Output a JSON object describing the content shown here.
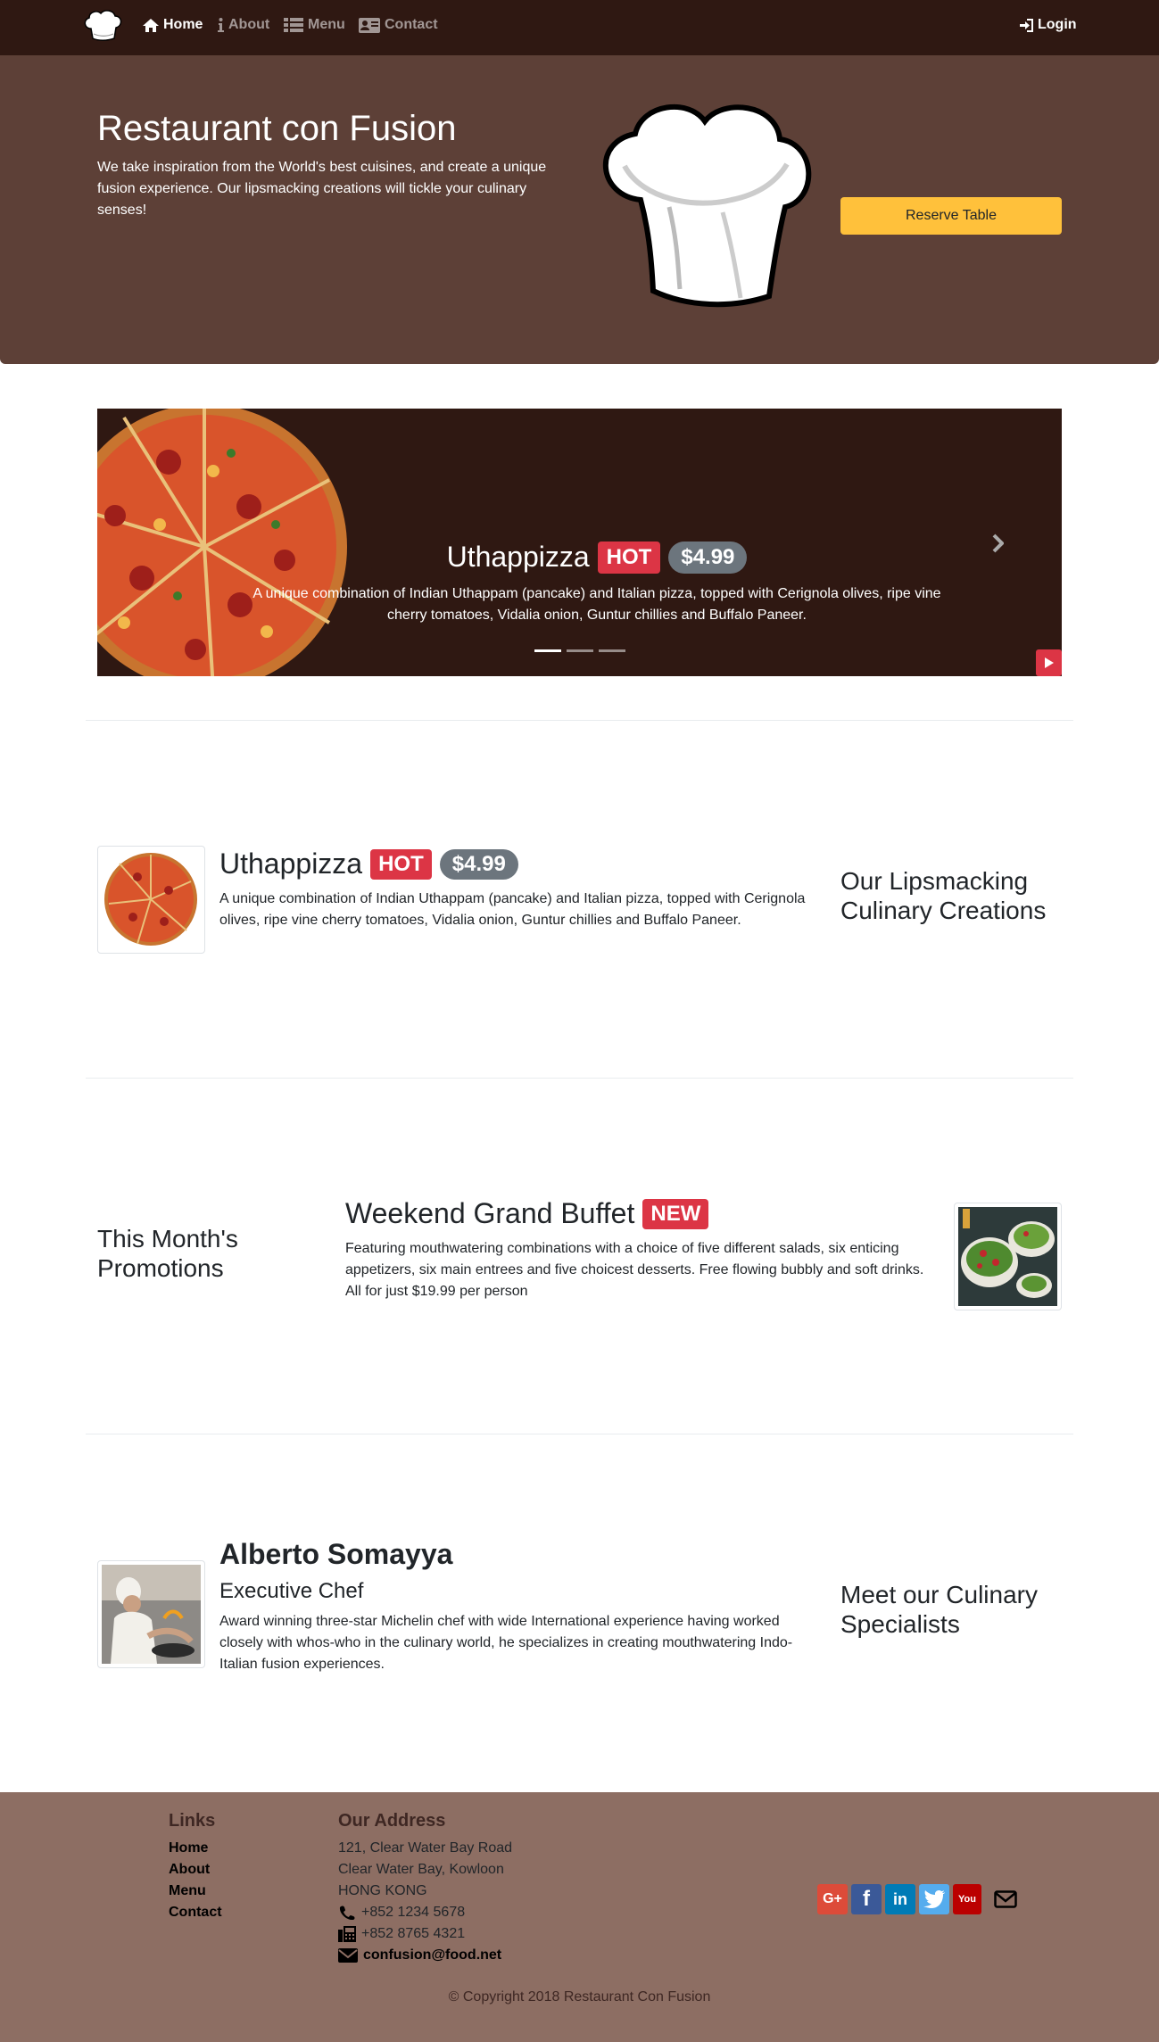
{
  "nav": {
    "items": [
      {
        "label": "Home",
        "icon": "home-icon"
      },
      {
        "label": "About",
        "icon": "info-icon"
      },
      {
        "label": "Menu",
        "icon": "list-icon"
      },
      {
        "label": "Contact",
        "icon": "address-card-icon"
      }
    ],
    "login_label": "Login"
  },
  "jumbotron": {
    "title": "Restaurant con Fusion",
    "text": "We take inspiration from the World's best cuisines, and create a unique fusion experience. Our lipsmacking creations will tickle your culinary senses!",
    "reserve_label": "Reserve Table"
  },
  "carousel": {
    "title": "Uthappizza",
    "badge": "HOT",
    "price": "$4.99",
    "description": "A unique combination of Indian Uthappam (pancake) and Italian pizza, topped with Cerignola olives, ripe vine cherry tomatoes, Vidalia onion, Guntur chillies and Buffalo Paneer.",
    "active_slide": 1,
    "slide_count": 3
  },
  "dish": {
    "title": "Uthappizza",
    "badge": "HOT",
    "price": "$4.99",
    "description": "A unique combination of Indian Uthappam (pancake) and Italian pizza, topped with Cerignola olives, ripe vine cherry tomatoes, Vidalia onion, Guntur chillies and Buffalo Paneer.",
    "side_heading": "Our Lipsmacking Culinary Creations"
  },
  "promotion": {
    "side_heading": "This Month's Promotions",
    "title": "Weekend Grand Buffet",
    "badge": "NEW",
    "description": "Featuring mouthwatering combinations with a choice of five different salads, six enticing appetizers, six main entrees and five choicest desserts. Free flowing bubbly and soft drinks. All for just $19.99 per person"
  },
  "leader": {
    "name": "Alberto Somayya",
    "designation": "Executive Chef",
    "description": "Award winning three-star Michelin chef with wide International experience having worked closely with whos-who in the culinary world, he specializes in creating mouthwatering Indo-Italian fusion experiences.",
    "side_heading": "Meet our Culinary Specialists"
  },
  "footer": {
    "links_heading": "Links",
    "links": [
      "Home",
      "About",
      "Menu",
      "Contact"
    ],
    "address_heading": "Our Address",
    "address": [
      "121, Clear Water Bay Road",
      "Clear Water Bay, Kowloon",
      "HONG KONG"
    ],
    "phone": "+852 1234 5678",
    "fax": "+852 8765 4321",
    "email": "confusion@food.net",
    "social": [
      {
        "name": "google-plus",
        "glyph": "G+",
        "color": "#dd4b39"
      },
      {
        "name": "facebook",
        "glyph": "f",
        "color": "#3b5998"
      },
      {
        "name": "linkedin",
        "glyph": "in",
        "color": "#007bb6"
      },
      {
        "name": "twitter",
        "glyph": "t",
        "color": "#55acee"
      },
      {
        "name": "youtube",
        "glyph": "You",
        "color": "#bb0000"
      },
      {
        "name": "mail",
        "glyph": "",
        "color": "transparent"
      }
    ],
    "copyright": "© Copyright 2018 Restaurant Con Fusion"
  },
  "colors": {
    "navbar": "#2f1812",
    "jumbotron": "#5d4037",
    "footer": "#8d6e63",
    "accent": "#ffc13b",
    "danger": "#dc3545",
    "secondary": "#6c757d"
  }
}
